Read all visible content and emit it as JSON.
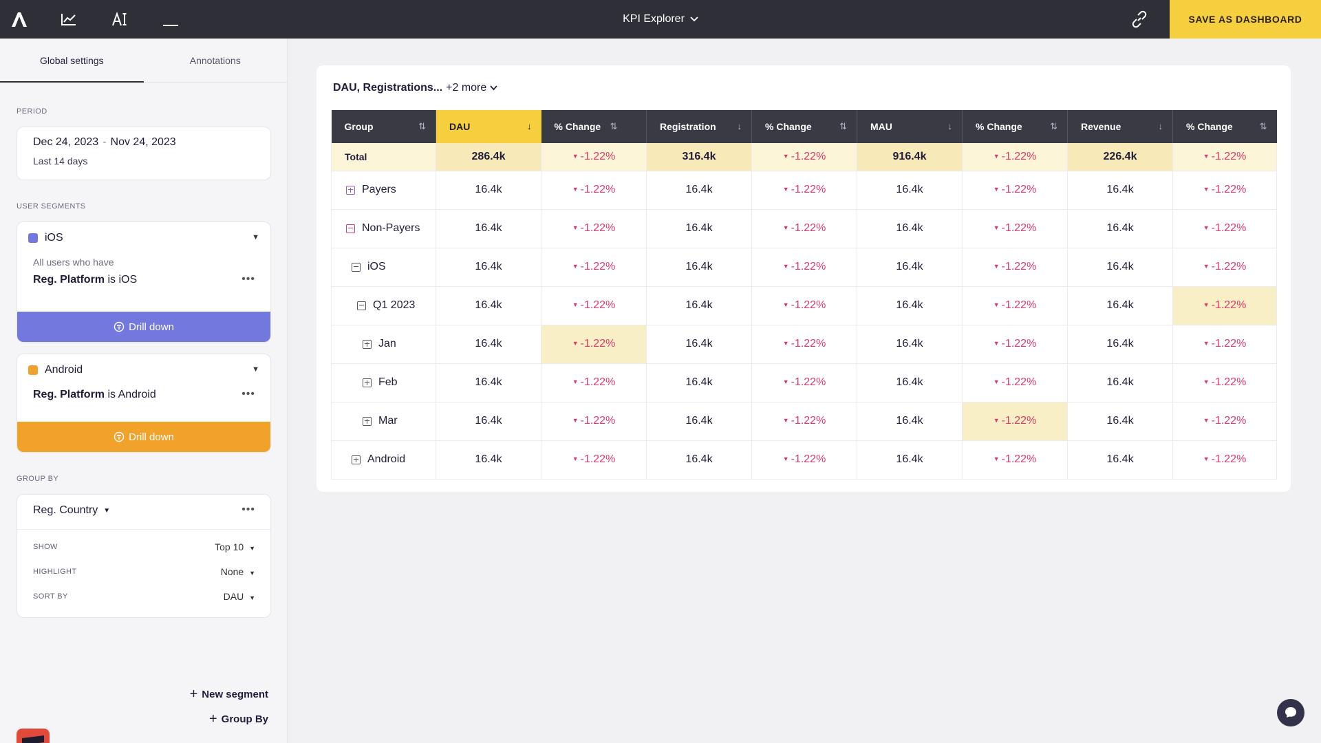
{
  "topbar": {
    "title": "KPI Explorer",
    "save_label": "SAVE AS DASHBOARD",
    "icons": [
      "app-logo-icon",
      "line-chart-icon",
      "text-ai-icon",
      "minimize-icon",
      "link-icon",
      "chevron-down-icon"
    ]
  },
  "sidebar": {
    "tabs": [
      {
        "label": "Global settings"
      },
      {
        "label": "Annotations"
      }
    ],
    "period": {
      "label": "PERIOD",
      "start": "Dec 24, 2023",
      "sep": "-",
      "end": "Nov 24, 2023",
      "sub": "Last 14 days"
    },
    "segments_label": "USER SEGMENTS",
    "segments": [
      {
        "name": "iOS",
        "color": "#7378de",
        "desc": "All users who have",
        "rule_field": "Reg. Platform",
        "rule_op": " is ",
        "rule_value": "iOS",
        "drill": "Drill down"
      },
      {
        "name": "Android",
        "color": "#f1a22a",
        "desc": "",
        "rule_field": "Reg. Platform",
        "rule_op": " is ",
        "rule_value": "Android",
        "drill": "Drill down"
      }
    ],
    "group_by": {
      "label": "GROUP BY",
      "field": "Reg. Country",
      "rows": [
        {
          "key": "SHOW",
          "value": "Top 10"
        },
        {
          "key": "HIGHLIGHT",
          "value": "None"
        },
        {
          "key": "SORT BY",
          "value": "DAU"
        }
      ]
    },
    "new_segment": "New segment",
    "add_group_by": "Group By"
  },
  "main": {
    "metrics_bold": "DAU, Registrations...",
    "metrics_more": "+2 more",
    "columns": [
      "Group",
      "DAU",
      "% Change",
      "Registration",
      "% Change",
      "MAU",
      "% Change",
      "Revenue",
      "% Change"
    ],
    "total": {
      "label": "Total",
      "values": [
        "286.4k",
        "-1.22%",
        "316.4k",
        "-1.22%",
        "916.4k",
        "-1.22%",
        "226.4k",
        "-1.22%"
      ]
    },
    "rows": [
      {
        "label": "Payers",
        "values": [
          "16.4k",
          "-1.22%",
          "16.4k",
          "-1.22%",
          "16.4k",
          "-1.22%",
          "16.4k",
          "-1.22%"
        ]
      },
      {
        "label": "Non-Payers",
        "values": [
          "16.4k",
          "-1.22%",
          "16.4k",
          "-1.22%",
          "16.4k",
          "-1.22%",
          "16.4k",
          "-1.22%"
        ]
      },
      {
        "label": "iOS",
        "values": [
          "16.4k",
          "-1.22%",
          "16.4k",
          "-1.22%",
          "16.4k",
          "-1.22%",
          "16.4k",
          "-1.22%"
        ]
      },
      {
        "label": "Q1 2023",
        "values": [
          "16.4k",
          "-1.22%",
          "16.4k",
          "-1.22%",
          "16.4k",
          "-1.22%",
          "16.4k",
          "-1.22%"
        ]
      },
      {
        "label": "Jan",
        "values": [
          "16.4k",
          "-1.22%",
          "16.4k",
          "-1.22%",
          "16.4k",
          "-1.22%",
          "16.4k",
          "-1.22%"
        ]
      },
      {
        "label": "Feb",
        "values": [
          "16.4k",
          "-1.22%",
          "16.4k",
          "-1.22%",
          "16.4k",
          "-1.22%",
          "16.4k",
          "-1.22%"
        ]
      },
      {
        "label": "Mar",
        "values": [
          "16.4k",
          "-1.22%",
          "16.4k",
          "-1.22%",
          "16.4k",
          "-1.22%",
          "16.4k",
          "-1.22%"
        ]
      },
      {
        "label": "Android",
        "values": [
          "16.4k",
          "-1.22%",
          "16.4k",
          "-1.22%",
          "16.4k",
          "-1.22%",
          "16.4k",
          "-1.22%"
        ]
      }
    ]
  },
  "colors": {
    "accent": "#f5cf3e",
    "topbar": "#2f2f38",
    "negative": "#e0386a",
    "ios": "#7378de",
    "android": "#f1a22a",
    "highlight": "#f8efc6"
  }
}
